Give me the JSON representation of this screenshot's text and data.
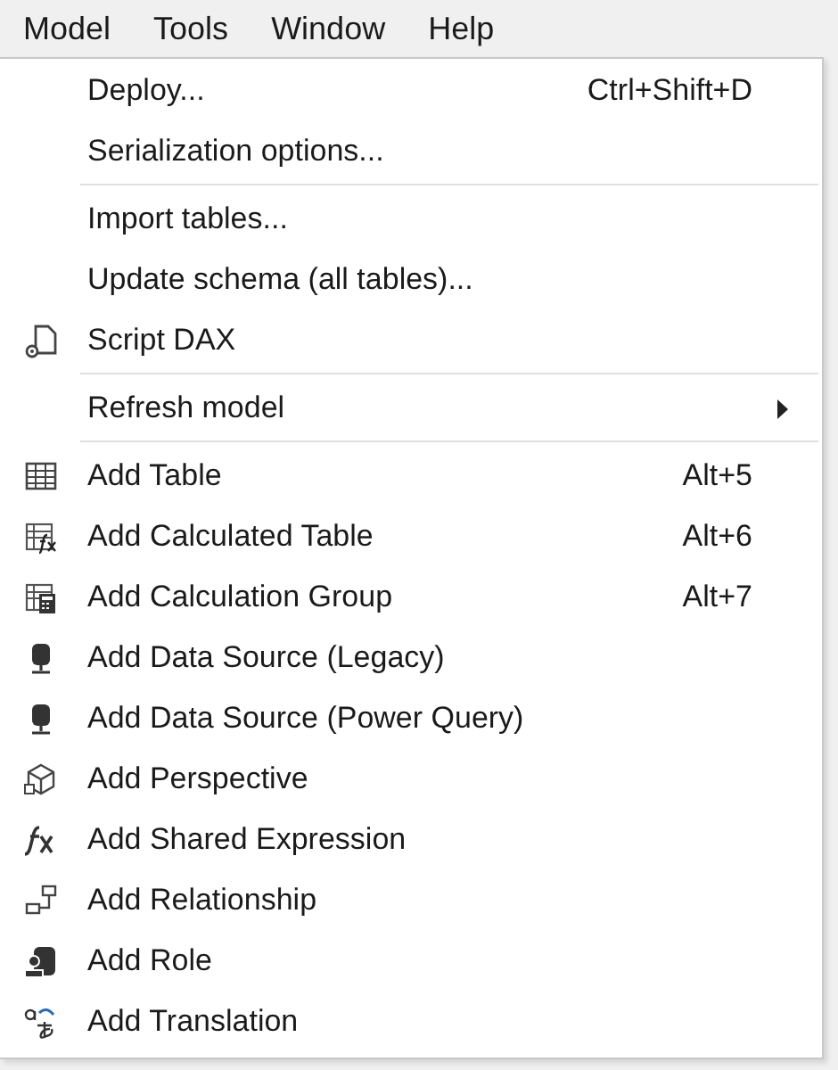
{
  "menu_bar": [
    {
      "label": "Model"
    },
    {
      "label": "Tools"
    },
    {
      "label": "Window"
    },
    {
      "label": "Help"
    }
  ],
  "dropdown": {
    "groups": [
      [
        {
          "label": "Deploy...",
          "shortcut": "Ctrl+Shift+D"
        },
        {
          "label": "Serialization options..."
        }
      ],
      [
        {
          "label": "Import tables..."
        },
        {
          "label": "Update schema (all tables)..."
        },
        {
          "label": "Script DAX",
          "kind": "script"
        }
      ],
      [
        {
          "label": "Refresh model",
          "submenu": true
        }
      ],
      [
        {
          "label": "Add Table",
          "shortcut": "Alt+5",
          "kind": "table"
        },
        {
          "label": "Add Calculated Table",
          "shortcut": "Alt+6",
          "kind": "calc-table"
        },
        {
          "label": "Add Calculation Group",
          "shortcut": "Alt+7",
          "kind": "calc-group"
        },
        {
          "label": "Add Data Source (Legacy)",
          "kind": "datasource"
        },
        {
          "label": "Add Data Source (Power Query)",
          "kind": "datasource"
        },
        {
          "label": "Add Perspective",
          "kind": "perspective"
        },
        {
          "label": "Add Shared Expression",
          "kind": "fx"
        },
        {
          "label": "Add Relationship",
          "kind": "relationship"
        },
        {
          "label": "Add Role",
          "kind": "role"
        },
        {
          "label": "Add Translation",
          "kind": "translation"
        }
      ]
    ]
  }
}
